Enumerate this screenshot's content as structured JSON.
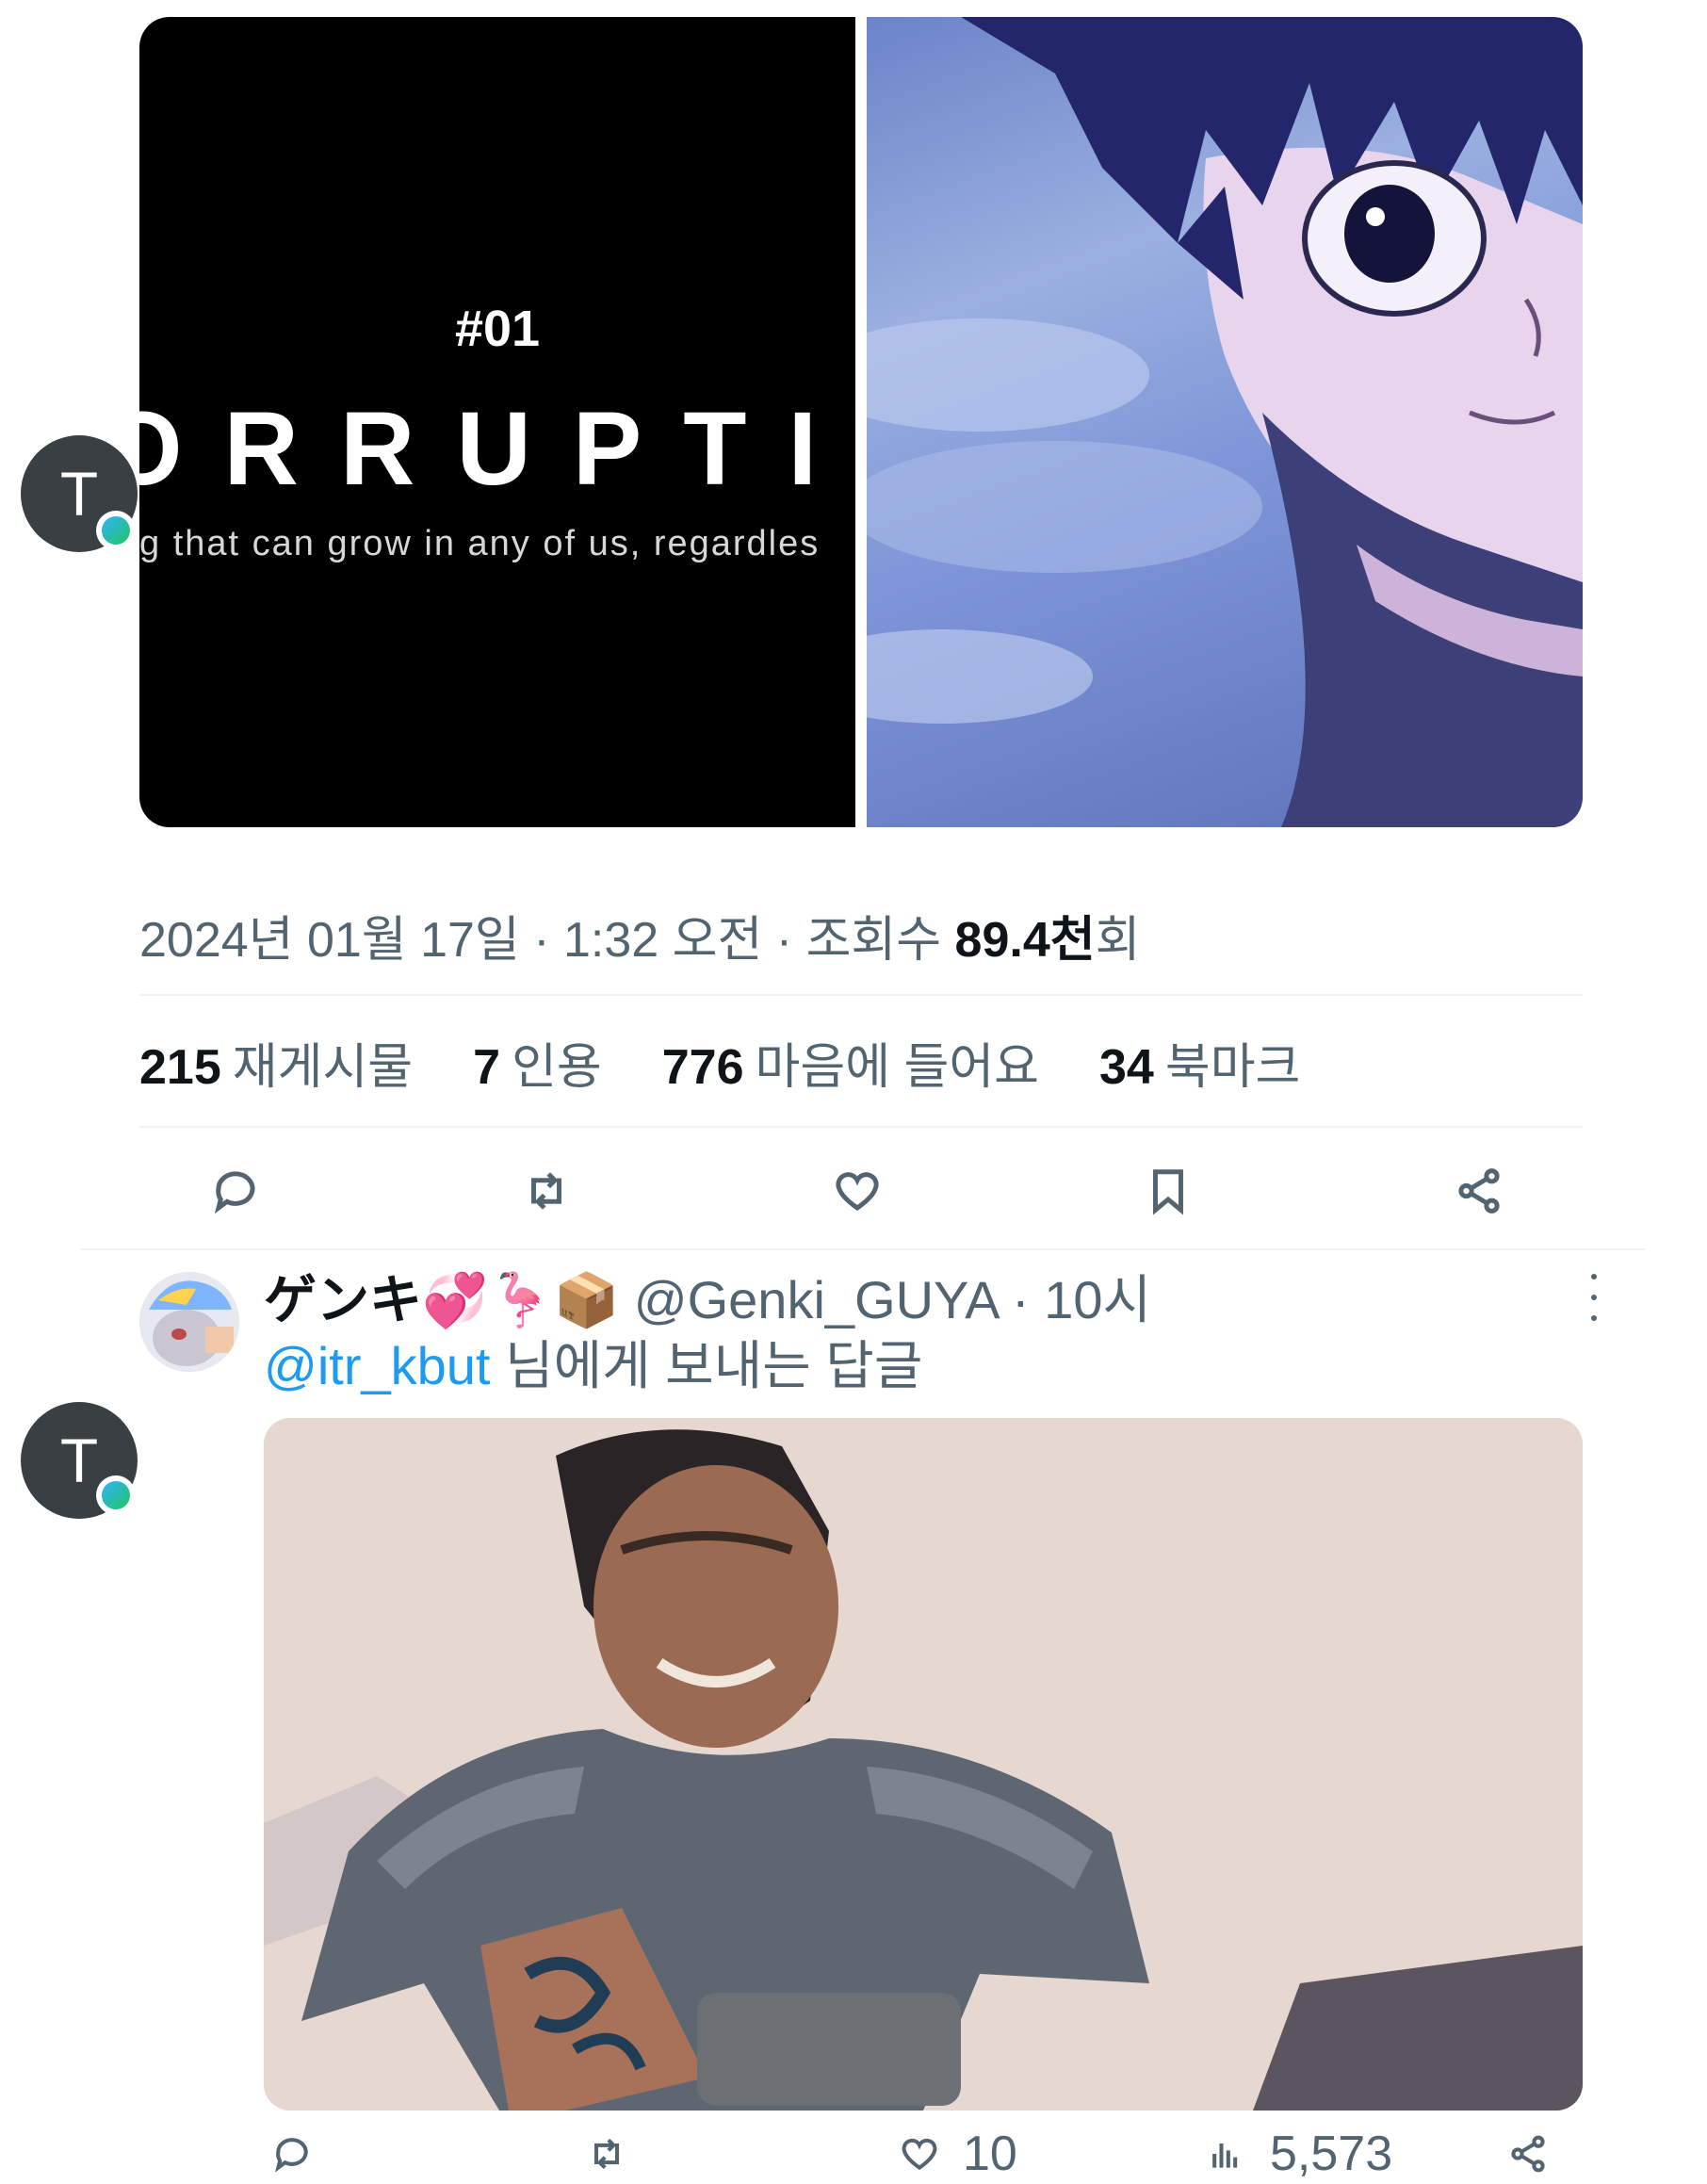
{
  "media": {
    "left_video": {
      "tag": "#01",
      "title": "ORRUPTI",
      "subtitle": "g that can grow in any of us, regardles"
    }
  },
  "tweet": {
    "avatar_letter": "T",
    "meta": {
      "date": "2024년 01월 17일",
      "time": "1:32 오전",
      "views_label": "조회수",
      "views_value": "89.4천",
      "views_suffix": "회",
      "sep": " · "
    },
    "stats": [
      {
        "num": "215",
        "label": "재게시물"
      },
      {
        "num": "7",
        "label": "인용"
      },
      {
        "num": "776",
        "label": "마음에 들어요"
      },
      {
        "num": "34",
        "label": "북마크"
      }
    ]
  },
  "reply": {
    "display_name": "ゲンキ💞🦩📦",
    "handle": "@Genki_GUYA",
    "time": "10시",
    "sep": " · ",
    "replying_to": "@itr_kbut",
    "replying_suffix": " 님에게 보내는 답글",
    "avatar_letter": "T",
    "counts": {
      "likes": "10",
      "views": "5,573"
    }
  },
  "colors": {
    "text": "#0f1419",
    "secondary": "#536471",
    "link": "#1d9bf0",
    "divider": "#eff3f4"
  }
}
